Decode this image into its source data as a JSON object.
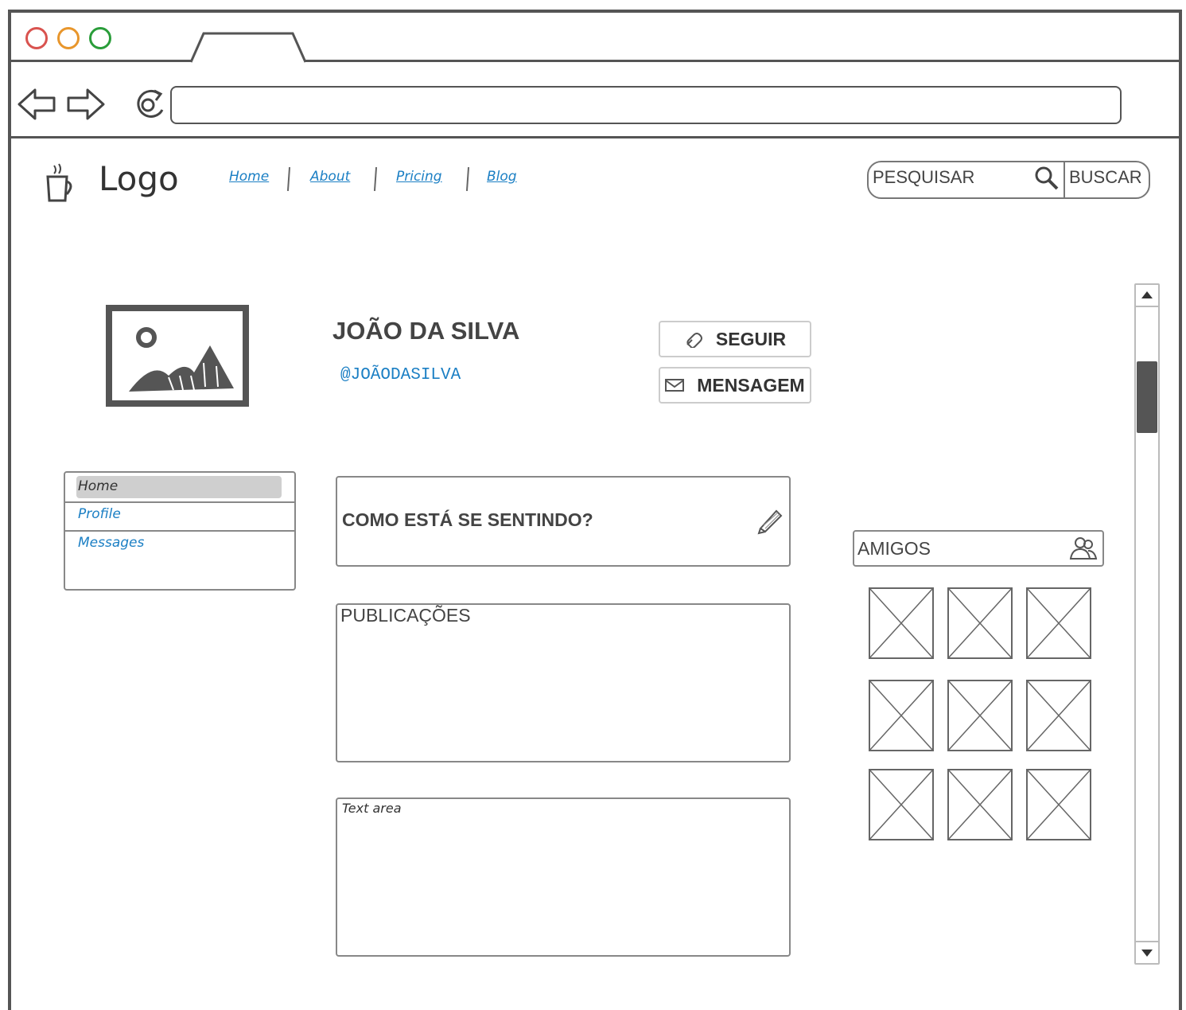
{
  "browser": {
    "traffic_lights": {
      "close": "#d9534f",
      "minimize": "#e8962c",
      "maximize": "#2a9d3a"
    },
    "address": ""
  },
  "header": {
    "logo_text": "Logo",
    "nav": [
      "Home",
      "About",
      "Pricing",
      "Blog"
    ],
    "search": {
      "placeholder": "PESQUISAR",
      "button": "BUSCAR"
    }
  },
  "profile": {
    "name": "JOÃO DA SILVA",
    "handle": "@JOÃODASILVA",
    "follow_label": "SEGUIR",
    "message_label": "MENSAGEM"
  },
  "sidebar": {
    "items": [
      {
        "label": "Home",
        "selected": true
      },
      {
        "label": "Profile",
        "selected": false
      },
      {
        "label": "Messages",
        "selected": false
      }
    ]
  },
  "composer": {
    "placeholder": "COMO ESTÁ SE SENTINDO?"
  },
  "posts": {
    "title": "PUBLICAÇÕES"
  },
  "textarea": {
    "placeholder": "Text area"
  },
  "friends": {
    "title": "AMIGOS",
    "count": 9
  },
  "colors": {
    "link": "#1b7fc4",
    "frame": "#555555"
  }
}
